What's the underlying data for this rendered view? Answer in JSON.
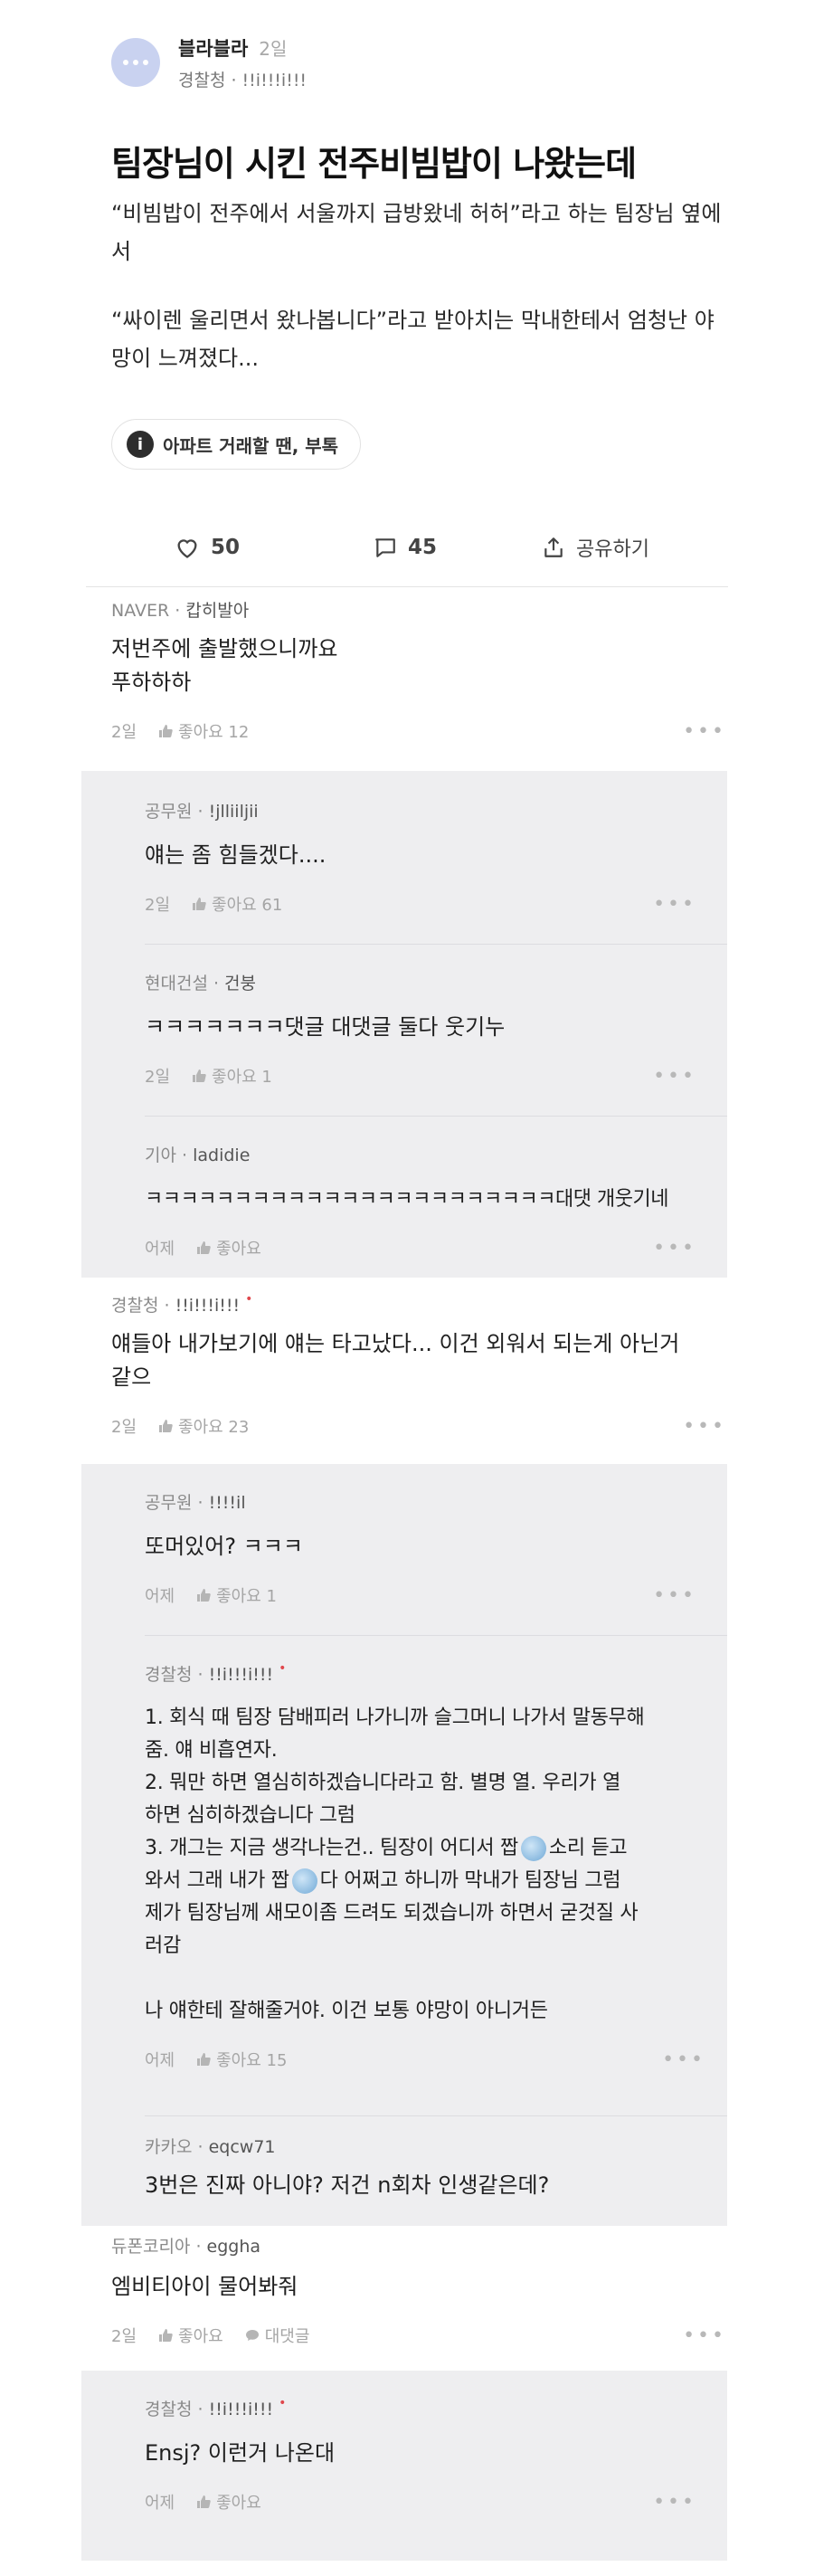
{
  "post": {
    "board": "블라블라",
    "time": "2일",
    "author": "경찰청 · !!i!!!i!!!",
    "title": "팀장님이 시킨 전주비빔밥이 나왔는데",
    "body1": "“비빔밥이 전주에서 서울까지 급방왔네 허허”라고 하는 팀장님 옆에서",
    "body2": "“싸이렌 울리면서 왔나봅니다”라고 받아치는 막내한테서 엄청난 야망이 느껴졌다...",
    "tag": "아파트 거래할 땐, 부톡"
  },
  "actions": {
    "likes": "50",
    "comments": "45",
    "share": "공유하기"
  },
  "comments": [
    {
      "company": "NAVER",
      "nick": "캅히발아",
      "red_dot": false,
      "text1": "저번주에 출발했으니까요",
      "text2": "푸하하하",
      "time": "2일",
      "likes": "좋아요 12",
      "reply": ""
    },
    {
      "company": "공무원",
      "nick": "!jlliiljii",
      "red_dot": false,
      "text1": "얘는 좀 힘들겠다....",
      "time": "2일",
      "likes": "좋아요 61",
      "reply": ""
    },
    {
      "company": "현대건설",
      "nick": "건붕",
      "red_dot": false,
      "text1": "ㅋㅋㅋㅋㅋㅋㅋ댓글 대댓글 둘다 웃기누",
      "time": "2일",
      "likes": "좋아요 1",
      "reply": ""
    },
    {
      "company": "기아",
      "nick": "ladidie",
      "red_dot": false,
      "text1": "ㅋㅋㅋㅋㅋㅋㅋㅋㅋㅋㅋㅋㅋㅋㅋㅋㅋㅋㅋㅋㅋㅋㅋ대댓 개웃기네",
      "time": "어제",
      "likes": "좋아요",
      "reply": ""
    },
    {
      "company": "경찰청",
      "nick": "!!i!!!i!!!",
      "red_dot": true,
      "text1": "얘들아 내가보기에 얘는 타고났다... 이건 외워서 되는게 아닌거",
      "text2": "같으",
      "time": "2일",
      "likes": "좋아요 23",
      "reply": ""
    },
    {
      "company": "공무원",
      "nick": "!!!!il",
      "red_dot": false,
      "text1": "또머있어? ㅋㅋㅋ",
      "time": "어제",
      "likes": "좋아요 1",
      "reply": ""
    },
    {
      "company": "경찰청",
      "nick": "!!i!!!i!!!",
      "red_dot": true,
      "lines": [
        "1. 회식 때 팀장 담배피러 나가니까 슬그머니 나가서 말동무해",
        "줌. 얘 비흡연자.",
        "2. 뭐만 하면 열심히하겠습니다라고 함. 별명 열. 우리가 열",
        "하면 심히하겠습니다 그럼",
        "3. 개그는 지금 생각나는건.. 팀장이 어디서 짭",
        "소리 듣고",
        "와서 그래 내가 짭",
        "다 어쩌고 하니까 막내가 팀장님 그럼",
        "제가 팀장님께 새모이좀 드려도 되겠습니까 하면서 굳것질 사",
        "러감",
        "나 얘한테 잘해줄거야. 이건 보통 야망이 아니거든"
      ],
      "time": "어제",
      "likes": "좋아요 15",
      "reply": ""
    },
    {
      "company": "카카오",
      "nick": "eqcw71",
      "red_dot": false,
      "text1": "3번은 진짜 아니야? 저건 n회차 인생같은데?",
      "time": "",
      "likes": "",
      "reply": ""
    },
    {
      "company": "듀폰코리아",
      "nick": "eggha",
      "red_dot": false,
      "text1": "엠비티아이 물어봐줘",
      "time": "2일",
      "likes": "좋아요",
      "reply": "대댓글"
    },
    {
      "company": "경찰청",
      "nick": "!!i!!!i!!!",
      "red_dot": true,
      "text1": "Ensj? 이런거 나온대",
      "time": "어제",
      "likes": "좋아요",
      "reply": ""
    }
  ],
  "colors": {
    "reply_bg": "#eeeef0",
    "avatar": "#c9d2f0",
    "red_dot": "#e0474c"
  }
}
